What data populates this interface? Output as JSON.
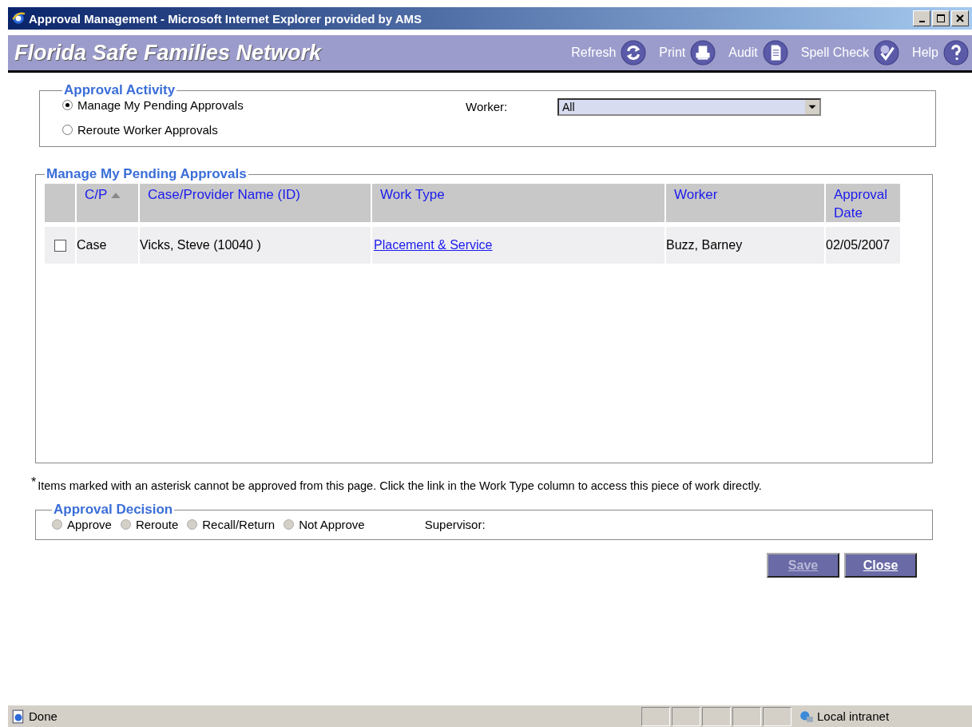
{
  "window": {
    "title": "Approval Management - Microsoft Internet Explorer provided by AMS"
  },
  "banner": {
    "app_title": "Florida Safe Families Network",
    "tools": [
      {
        "label": "Refresh",
        "kind": "refresh"
      },
      {
        "label": "Print",
        "kind": "print"
      },
      {
        "label": "Audit",
        "kind": "audit"
      },
      {
        "label": "Spell Check",
        "kind": "spell"
      },
      {
        "label": "Help",
        "kind": "help"
      }
    ]
  },
  "approval_activity": {
    "legend": "Approval Activity",
    "options": [
      {
        "label": "Manage My Pending Approvals",
        "selected": true
      },
      {
        "label": "Reroute Worker Approvals",
        "selected": false
      }
    ],
    "worker_label": "Worker:",
    "worker_value": "All"
  },
  "pending": {
    "legend": "Manage My Pending Approvals",
    "columns": [
      {
        "label": "C/P",
        "sorted": true
      },
      {
        "label": "Case/Provider Name (ID)",
        "sorted": false
      },
      {
        "label": "Work Type",
        "sorted": false
      },
      {
        "label": "Worker",
        "sorted": false
      },
      {
        "label": "Approval Date",
        "sorted": false
      }
    ],
    "rows": [
      {
        "checked": false,
        "cp": "Case",
        "name": "Vicks, Steve (10040 )",
        "work_type": "Placement & Service",
        "worker": "Buzz, Barney",
        "date": "02/05/2007"
      }
    ]
  },
  "note": {
    "mark": "*",
    "text": "Items marked with an asterisk cannot be approved from this page. Click the link in the Work Type column to access this piece of work directly."
  },
  "decision": {
    "legend": "Approval Decision",
    "options": [
      {
        "label": "Approve",
        "selected": false,
        "disabled": true
      },
      {
        "label": "Reroute",
        "selected": false,
        "disabled": true
      },
      {
        "label": "Recall/Return",
        "selected": false,
        "disabled": true
      },
      {
        "label": "Not Approve",
        "selected": false,
        "disabled": true
      }
    ],
    "supervisor_label": "Supervisor:"
  },
  "buttons": [
    {
      "label": "Save",
      "disabled": true
    },
    {
      "label": "Close",
      "disabled": false
    }
  ],
  "status_bar": {
    "text": "Done",
    "zone": "Local intranet"
  }
}
